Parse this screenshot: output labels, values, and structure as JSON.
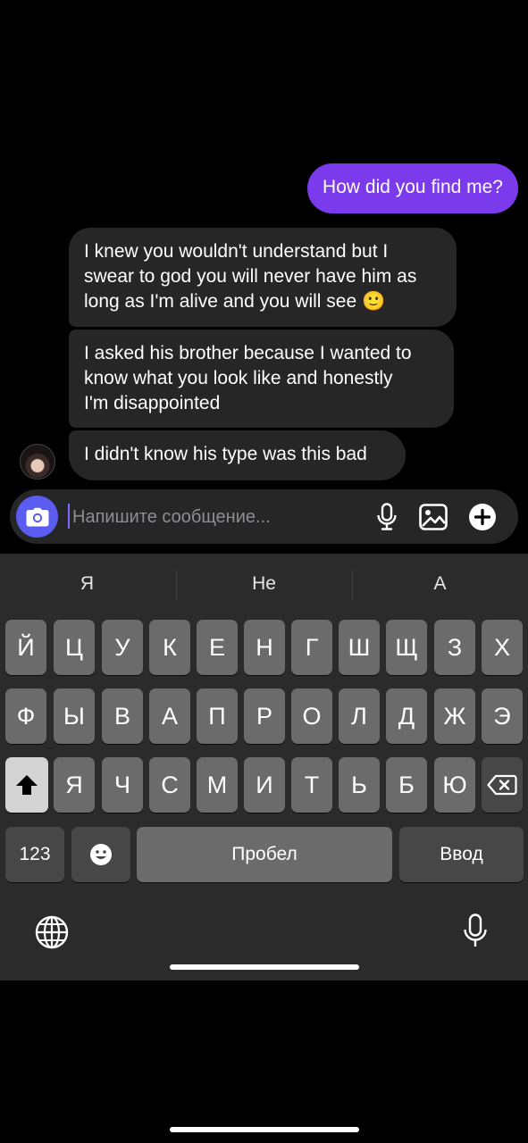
{
  "messages": [
    {
      "direction": "out",
      "text": "How did you find me?"
    },
    {
      "direction": "in",
      "text": "I knew you wouldn't understand but I\nswear to god you will never have him as\nlong as I'm alive and you will see 🙂"
    },
    {
      "direction": "in",
      "text": "I asked his brother because I wanted to\nknow what you look like and honestly\nI'm disappointed"
    },
    {
      "direction": "in",
      "text": "I didn't know his type was this bad"
    }
  ],
  "composer": {
    "placeholder": "Напишите сообщение...",
    "icons": [
      "camera-icon",
      "microphone-icon",
      "gallery-icon",
      "plus-icon"
    ]
  },
  "keyboard": {
    "suggestions": [
      "Я",
      "Не",
      "А"
    ],
    "row1": [
      "Й",
      "Ц",
      "У",
      "К",
      "Е",
      "Н",
      "Г",
      "Ш",
      "Щ",
      "З",
      "Х"
    ],
    "row2": [
      "Ф",
      "Ы",
      "В",
      "А",
      "П",
      "Р",
      "О",
      "Л",
      "Д",
      "Ж",
      "Э"
    ],
    "row3": [
      "Я",
      "Ч",
      "С",
      "М",
      "И",
      "Т",
      "Ь",
      "Б",
      "Ю"
    ],
    "numbers_label": "123",
    "space_label": "Пробел",
    "enter_label": "Ввод",
    "icons": [
      "shift-icon",
      "backspace-icon",
      "emoji-icon",
      "globe-icon",
      "dictation-icon"
    ]
  },
  "colors": {
    "accent": "#7c3aed",
    "camera_button": "#5b5cf0",
    "incoming_bubble": "#262626",
    "keyboard_bg": "#2b2b2b"
  }
}
